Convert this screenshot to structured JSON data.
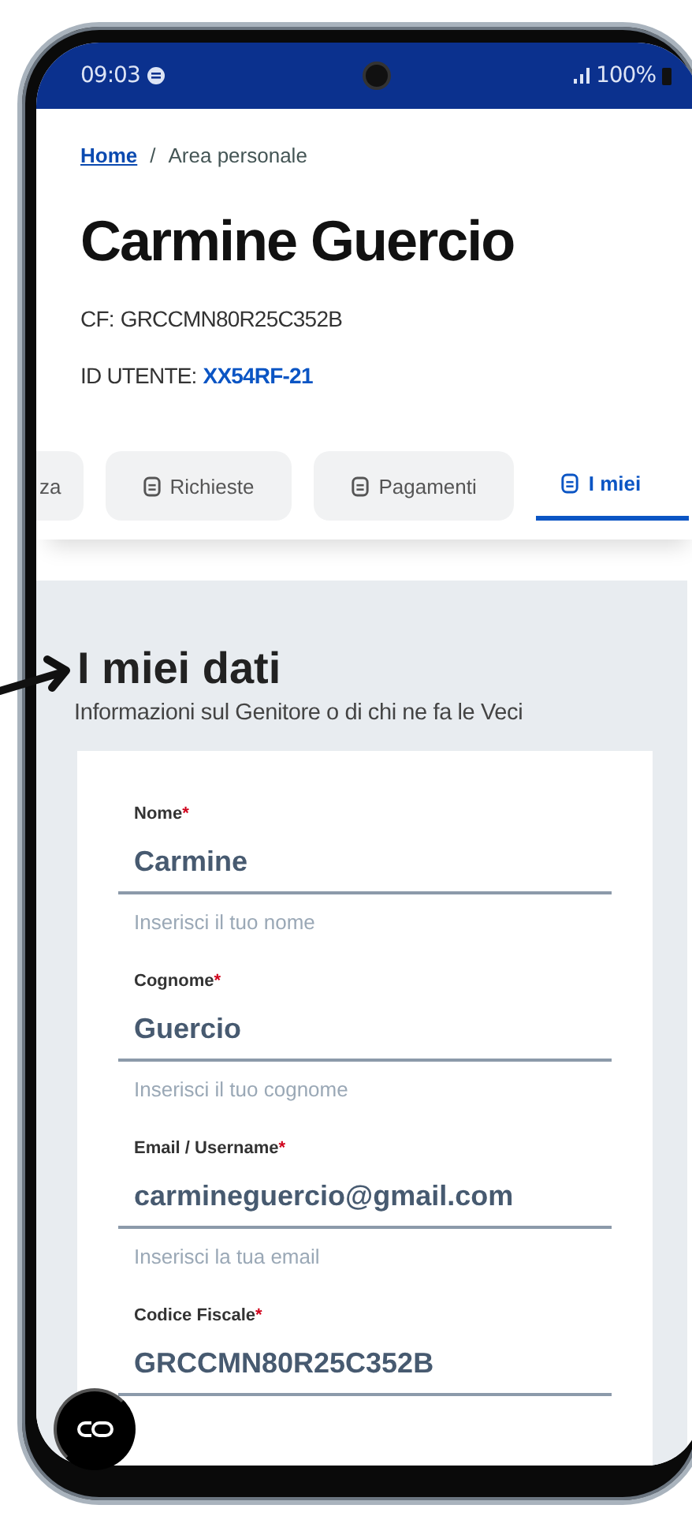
{
  "status_bar": {
    "time": "09:03",
    "battery": "100%"
  },
  "breadcrumb": [
    {
      "label": "Home",
      "kind": "link"
    },
    {
      "label": "Area personale",
      "kind": "current"
    }
  ],
  "breadcrumb_separator": "/",
  "title": "Carmine Guercio",
  "cf": {
    "label": "CF:",
    "value": "GRCCMN80R25C352B"
  },
  "user_id": {
    "label": "ID UTENTE:",
    "value": "XX54RF-21"
  },
  "tabs": [
    {
      "label": "za",
      "icon": false,
      "selected": false
    },
    {
      "label": "Richieste",
      "icon": true,
      "selected": false
    },
    {
      "label": "Pagamenti",
      "icon": true,
      "selected": false
    },
    {
      "label": "I miei",
      "icon": true,
      "selected": true
    }
  ],
  "section": {
    "title": "I miei dati",
    "subtitle": "Informazioni sul Genitore o di chi ne fa le Veci"
  },
  "fields": [
    {
      "label": "Nome",
      "required": true,
      "value": "Carmine",
      "hint": "Inserisci il tuo nome"
    },
    {
      "label": "Cognome",
      "required": true,
      "value": "Guercio",
      "hint": "Inserisci il tuo cognome"
    },
    {
      "label": "Email / Username",
      "required": true,
      "value": "carmineguercio@gmail.com",
      "hint": "Inserisci la tua email"
    },
    {
      "label": "Codice Fiscale",
      "required": true,
      "value": "GRCCMN80R25C352B"
    }
  ],
  "required_mark": "*"
}
